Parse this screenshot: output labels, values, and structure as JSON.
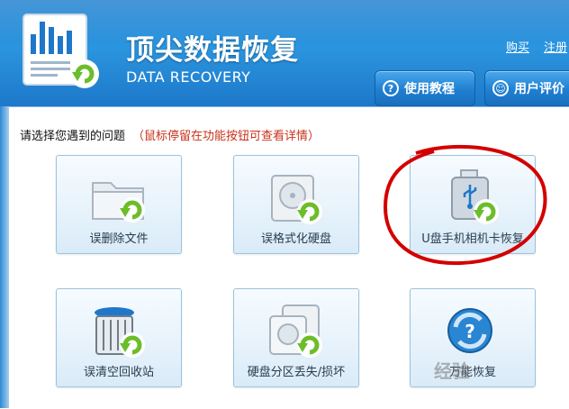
{
  "header": {
    "title": "顶尖数据恢复",
    "subtitle": "DATA RECOVERY",
    "links": {
      "buy": "购买",
      "register": "注册"
    },
    "buttons": {
      "tutorial": "使用教程",
      "review": "用户评价"
    }
  },
  "main": {
    "prompt": "请选择您遇到的问题",
    "hint": "（鼠标停留在功能按钮可查看详情）",
    "options": [
      {
        "label": "误删除文件",
        "icon": "folder-recover-icon"
      },
      {
        "label": "误格式化硬盘",
        "icon": "harddisk-recover-icon"
      },
      {
        "label": "U盘手机相机卡恢复",
        "icon": "usb-drive-recover-icon"
      },
      {
        "label": "误清空回收站",
        "icon": "recycle-bin-recover-icon"
      },
      {
        "label": "硬盘分区丢失/损坏",
        "icon": "partition-recover-icon"
      },
      {
        "label": "万能恢复",
        "icon": "universal-recover-icon"
      }
    ]
  },
  "watermark": "经验",
  "colors": {
    "header": "#2b95df",
    "accent_green": "#6cbd2a",
    "hint_red": "#c8321a",
    "annotation": "#d40000"
  }
}
